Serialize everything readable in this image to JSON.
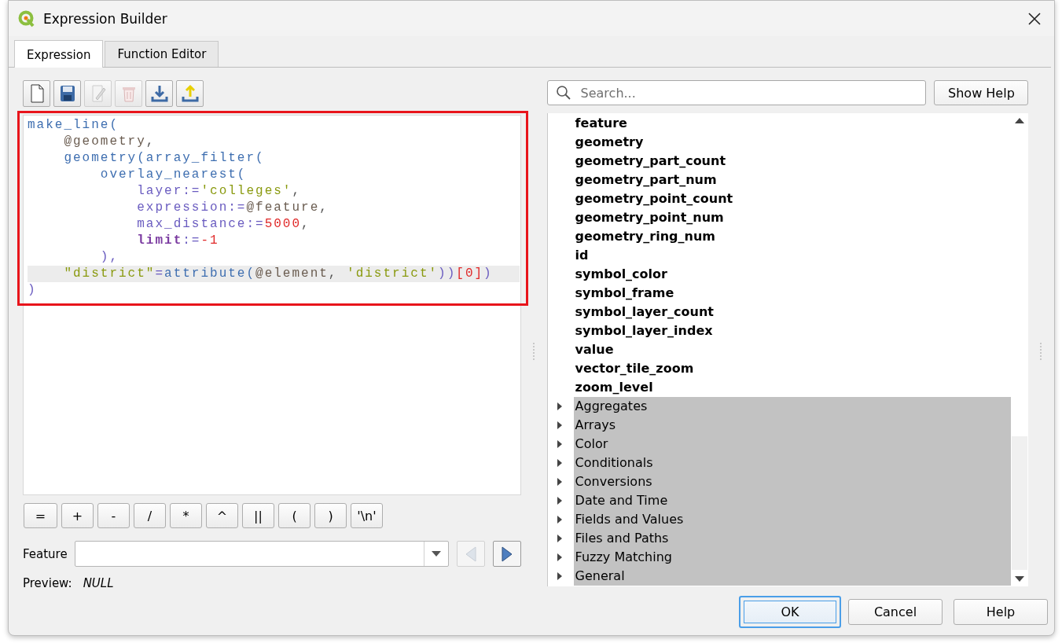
{
  "window": {
    "title": "Expression Builder"
  },
  "tabs": [
    {
      "label": "Expression",
      "selected": true
    },
    {
      "label": "Function Editor",
      "selected": false
    }
  ],
  "toolbar": [
    {
      "kind": "new",
      "disabled": false
    },
    {
      "kind": "save",
      "disabled": false
    },
    {
      "kind": "edit",
      "disabled": true
    },
    {
      "kind": "delete",
      "disabled": true
    },
    {
      "kind": "import",
      "disabled": false
    },
    {
      "kind": "export",
      "disabled": false
    }
  ],
  "editor": {
    "highlighted": true,
    "lines": [
      {
        "current": false,
        "tokens": [
          {
            "kind": "function",
            "text": "make_line("
          }
        ]
      },
      {
        "current": false,
        "tokens": [
          {
            "kind": "variable",
            "text": "    @geometry"
          },
          {
            "kind": "operator",
            "text": ","
          }
        ]
      },
      {
        "current": false,
        "tokens": [
          {
            "kind": "function",
            "text": "    geometry(array_filter("
          }
        ]
      },
      {
        "current": false,
        "tokens": [
          {
            "kind": "function",
            "text": "        overlay_nearest("
          }
        ]
      },
      {
        "current": false,
        "tokens": [
          {
            "kind": "param",
            "text": "            layer:="
          },
          {
            "kind": "string",
            "text": "'colleges'"
          },
          {
            "kind": "operator",
            "text": ","
          }
        ]
      },
      {
        "current": false,
        "tokens": [
          {
            "kind": "param",
            "text": "            expression:="
          },
          {
            "kind": "variable",
            "text": "@feature"
          },
          {
            "kind": "operator",
            "text": ","
          }
        ]
      },
      {
        "current": false,
        "tokens": [
          {
            "kind": "param",
            "text": "            max_distance:="
          },
          {
            "kind": "number",
            "text": "5000"
          },
          {
            "kind": "operator",
            "text": ","
          }
        ]
      },
      {
        "current": false,
        "tokens": [
          {
            "kind": "keyword",
            "text": "            limit"
          },
          {
            "kind": "param",
            "text": ":="
          },
          {
            "kind": "number",
            "text": "-1"
          }
        ]
      },
      {
        "current": false,
        "tokens": [
          {
            "kind": "param",
            "text": "        ),"
          }
        ]
      },
      {
        "current": true,
        "tokens": [
          {
            "kind": "string",
            "text": "    \"district\""
          },
          {
            "kind": "param",
            "text": "="
          },
          {
            "kind": "function",
            "text": "attribute("
          },
          {
            "kind": "variable",
            "text": "@element"
          },
          {
            "kind": "operator",
            "text": ", "
          },
          {
            "kind": "string",
            "text": "'district'"
          },
          {
            "kind": "param",
            "text": "))"
          },
          {
            "kind": "number",
            "text": "[0]"
          },
          {
            "kind": "param",
            "text": ")"
          }
        ]
      },
      {
        "current": false,
        "tokens": [
          {
            "kind": "param",
            "text": ")"
          }
        ]
      }
    ]
  },
  "operators": [
    "=",
    "+",
    "-",
    "/",
    "*",
    "^",
    "||",
    "(",
    ")",
    "'\\n'"
  ],
  "feature": {
    "label": "Feature",
    "prev_disabled": true,
    "next_disabled": false
  },
  "preview": {
    "label": "Preview:",
    "value": "NULL"
  },
  "search": {
    "placeholder": "Search..."
  },
  "show_help": "Show Help",
  "tree": [
    {
      "kind": "variable",
      "label": "feature"
    },
    {
      "kind": "variable",
      "label": "geometry"
    },
    {
      "kind": "variable",
      "label": "geometry_part_count"
    },
    {
      "kind": "variable",
      "label": "geometry_part_num"
    },
    {
      "kind": "variable",
      "label": "geometry_point_count"
    },
    {
      "kind": "variable",
      "label": "geometry_point_num"
    },
    {
      "kind": "variable",
      "label": "geometry_ring_num"
    },
    {
      "kind": "variable",
      "label": "id"
    },
    {
      "kind": "variable",
      "label": "symbol_color"
    },
    {
      "kind": "variable",
      "label": "symbol_frame"
    },
    {
      "kind": "variable",
      "label": "symbol_layer_count"
    },
    {
      "kind": "variable",
      "label": "symbol_layer_index"
    },
    {
      "kind": "variable",
      "label": "value"
    },
    {
      "kind": "variable",
      "label": "vector_tile_zoom"
    },
    {
      "kind": "variable",
      "label": "zoom_level"
    },
    {
      "kind": "group",
      "label": "Aggregates",
      "expanded": false
    },
    {
      "kind": "group",
      "label": "Arrays",
      "expanded": false
    },
    {
      "kind": "group",
      "label": "Color",
      "expanded": false
    },
    {
      "kind": "group",
      "label": "Conditionals",
      "expanded": false
    },
    {
      "kind": "group",
      "label": "Conversions",
      "expanded": false
    },
    {
      "kind": "group",
      "label": "Date and Time",
      "expanded": false
    },
    {
      "kind": "group",
      "label": "Fields and Values",
      "expanded": false
    },
    {
      "kind": "group",
      "label": "Files and Paths",
      "expanded": false
    },
    {
      "kind": "group",
      "label": "Fuzzy Matching",
      "expanded": false
    },
    {
      "kind": "group",
      "label": "General",
      "expanded": false
    }
  ],
  "buttons": [
    {
      "label": "OK",
      "highlighted": true
    },
    {
      "label": "Cancel",
      "highlighted": false
    },
    {
      "label": "Help",
      "highlighted": false
    }
  ]
}
